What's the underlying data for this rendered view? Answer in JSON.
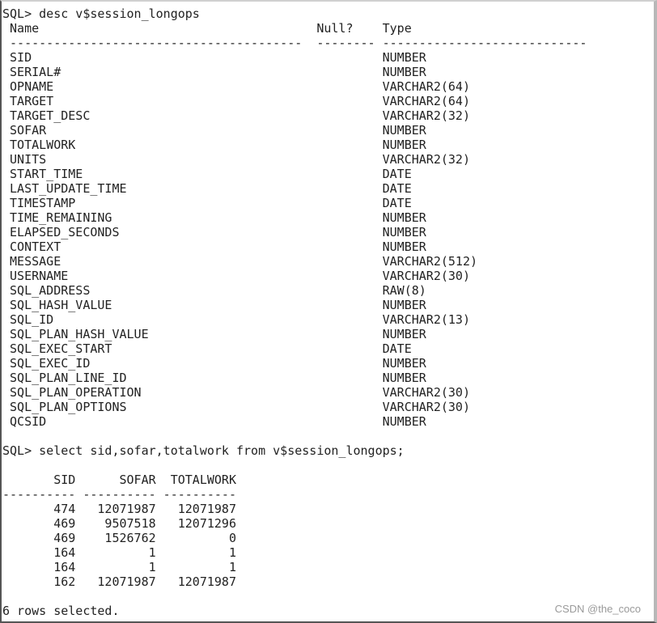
{
  "terminal": {
    "prompt": "SQL> ",
    "commands": {
      "desc": "desc v$session_longops",
      "select": "select sid,sofar,totalwork from v$session_longops;"
    },
    "desc_table": {
      "headers": {
        "name": "Name",
        "null": "Null?",
        "type": "Type"
      },
      "separators": {
        "name": "----------------------------------------",
        "null": "--------",
        "type": "----------------------------"
      },
      "rows": [
        {
          "name": "SID",
          "type": "NUMBER"
        },
        {
          "name": "SERIAL#",
          "type": "NUMBER"
        },
        {
          "name": "OPNAME",
          "type": "VARCHAR2(64)"
        },
        {
          "name": "TARGET",
          "type": "VARCHAR2(64)"
        },
        {
          "name": "TARGET_DESC",
          "type": "VARCHAR2(32)"
        },
        {
          "name": "SOFAR",
          "type": "NUMBER"
        },
        {
          "name": "TOTALWORK",
          "type": "NUMBER"
        },
        {
          "name": "UNITS",
          "type": "VARCHAR2(32)"
        },
        {
          "name": "START_TIME",
          "type": "DATE"
        },
        {
          "name": "LAST_UPDATE_TIME",
          "type": "DATE"
        },
        {
          "name": "TIMESTAMP",
          "type": "DATE"
        },
        {
          "name": "TIME_REMAINING",
          "type": "NUMBER"
        },
        {
          "name": "ELAPSED_SECONDS",
          "type": "NUMBER"
        },
        {
          "name": "CONTEXT",
          "type": "NUMBER"
        },
        {
          "name": "MESSAGE",
          "type": "VARCHAR2(512)"
        },
        {
          "name": "USERNAME",
          "type": "VARCHAR2(30)"
        },
        {
          "name": "SQL_ADDRESS",
          "type": "RAW(8)"
        },
        {
          "name": "SQL_HASH_VALUE",
          "type": "NUMBER"
        },
        {
          "name": "SQL_ID",
          "type": "VARCHAR2(13)"
        },
        {
          "name": "SQL_PLAN_HASH_VALUE",
          "type": "NUMBER"
        },
        {
          "name": "SQL_EXEC_START",
          "type": "DATE"
        },
        {
          "name": "SQL_EXEC_ID",
          "type": "NUMBER"
        },
        {
          "name": "SQL_PLAN_LINE_ID",
          "type": "NUMBER"
        },
        {
          "name": "SQL_PLAN_OPERATION",
          "type": "VARCHAR2(30)"
        },
        {
          "name": "SQL_PLAN_OPTIONS",
          "type": "VARCHAR2(30)"
        },
        {
          "name": "QCSID",
          "type": "NUMBER"
        }
      ]
    },
    "result_table": {
      "headers": [
        "SID",
        "SOFAR",
        "TOTALWORK"
      ],
      "separator": "----------",
      "rows": [
        [
          "474",
          "12071987",
          "12071987"
        ],
        [
          "469",
          "9507518",
          "12071296"
        ],
        [
          "469",
          "1526762",
          "0"
        ],
        [
          "164",
          "1",
          "1"
        ],
        [
          "164",
          "1",
          "1"
        ],
        [
          "162",
          "12071987",
          "12071987"
        ]
      ]
    },
    "footer": "6 rows selected."
  },
  "watermark": "CSDN @the_coco"
}
